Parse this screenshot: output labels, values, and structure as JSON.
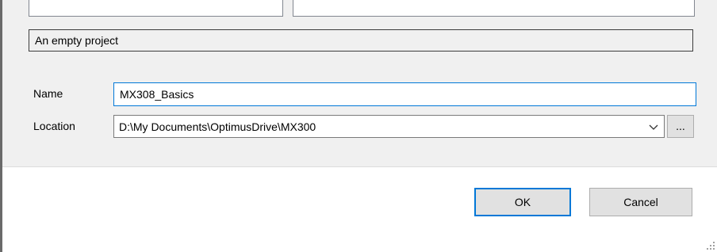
{
  "dialog": {
    "description": "An empty project",
    "name_label": "Name",
    "name_value": "MX308_Basics",
    "location_label": "Location",
    "location_value": "D:\\My Documents\\OptimusDrive\\MX300",
    "browse_label": "...",
    "ok_label": "OK",
    "cancel_label": "Cancel"
  },
  "icons": {
    "dropdown": "chevron-down-icon",
    "resize": "size-grip-icon"
  },
  "colors": {
    "panel_background": "#f0f0f0",
    "focus_accent": "#0078d7",
    "button_face": "#e1e1e1"
  }
}
